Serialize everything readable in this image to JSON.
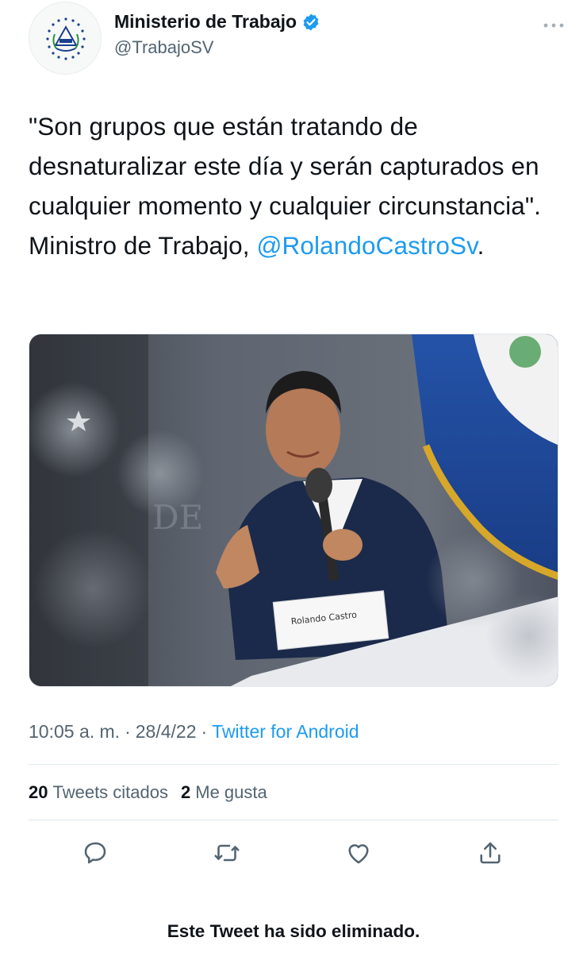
{
  "account": {
    "display_name": "Ministerio de Trabajo",
    "handle": "@TrabajoSV",
    "verified": true,
    "avatar_icon": "el-salvador-coat-of-arms-icon"
  },
  "tweet": {
    "text_before_mention": "\"Son grupos que están tratando de desnaturalizar este día y serán capturados en cualquier momento y cualquier circunstancia\". Ministro de Trabajo, ",
    "mention": "@RolandoCastroSv",
    "text_after_mention": ".",
    "image_alt": "Man in a dark suit speaking into a microphone at a press conference, with the flag of El Salvador behind him and a name placard reading Rolando Castro.",
    "image_placard_text": "Rolando Castro",
    "image_letters": "DE"
  },
  "meta": {
    "time": "10:05 a. m.",
    "separator_1": "·",
    "date": "28/4/22",
    "separator_2": "·",
    "source": "Twitter for Android"
  },
  "stats": {
    "quote_count": "20",
    "quote_label": "Tweets citados",
    "like_count": "2",
    "like_label": "Me gusta"
  },
  "actions": [
    {
      "name": "reply",
      "icon": "reply-icon"
    },
    {
      "name": "retweet",
      "icon": "retweet-icon"
    },
    {
      "name": "like",
      "icon": "heart-icon"
    },
    {
      "name": "share",
      "icon": "share-icon"
    }
  ],
  "footer": {
    "deleted_notice": "Este Tweet ha sido eliminado."
  },
  "colors": {
    "accent": "#1d9bf0",
    "text": "#0f1419",
    "muted": "#536471",
    "border": "#e1e8ed"
  }
}
